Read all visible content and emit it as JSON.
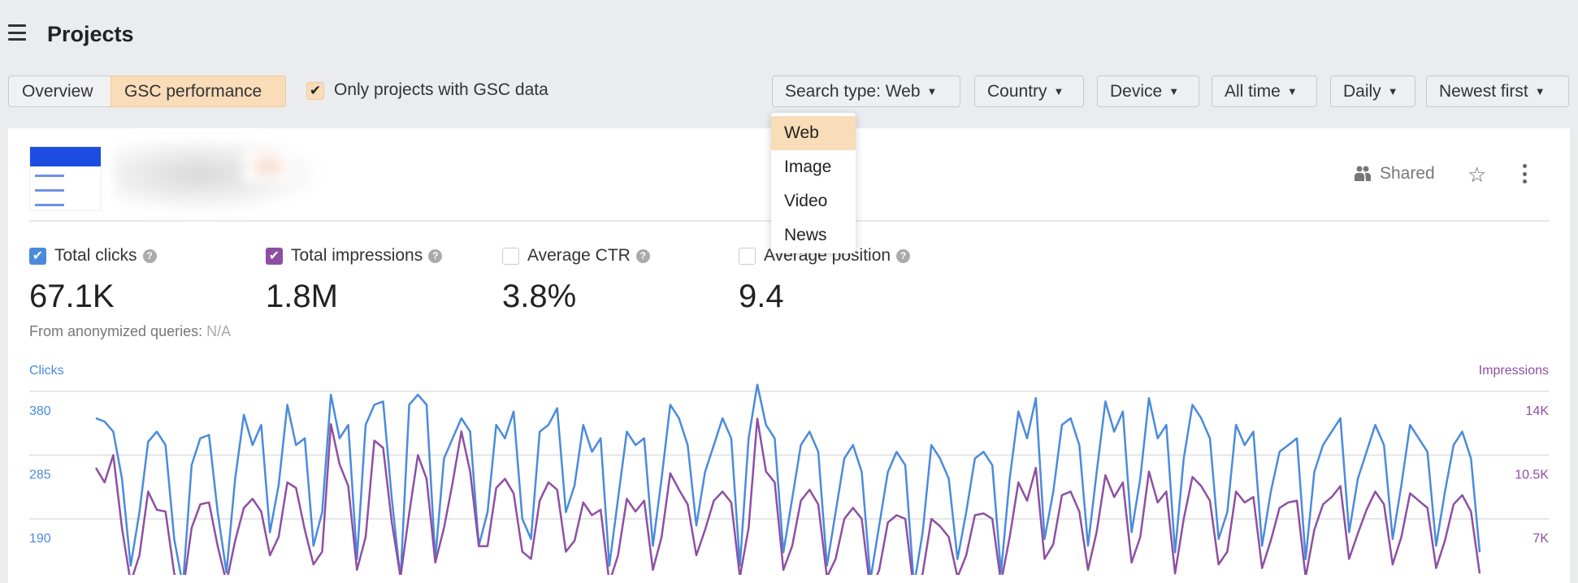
{
  "header": {
    "title": "Projects",
    "menu_icon": "hamburger-icon"
  },
  "tabs": [
    {
      "label": "Overview",
      "active": false
    },
    {
      "label": "GSC performance",
      "active": true
    }
  ],
  "gsc_filter": {
    "label": "Only projects with GSC data",
    "checked": true
  },
  "filters": [
    {
      "label": "Search type: Web"
    },
    {
      "label": "Country"
    },
    {
      "label": "Device"
    },
    {
      "label": "All time"
    },
    {
      "label": "Daily"
    },
    {
      "label": "Newest first"
    }
  ],
  "dropdown": {
    "items": [
      "Web",
      "Image",
      "Video",
      "News"
    ],
    "selected": "Web"
  },
  "project": {
    "shared_label": "Shared",
    "shared_icon": "users-icon",
    "star_icon": "star-icon",
    "more_icon": "more-vertical-icon"
  },
  "metrics": [
    {
      "label": "Total clicks",
      "value": "67.1K",
      "checked": true,
      "color": "#4a8bdc"
    },
    {
      "label": "Total impressions",
      "value": "1.8M",
      "checked": true,
      "color": "#8e4fa3"
    },
    {
      "label": "Average CTR",
      "value": "3.8%",
      "checked": false
    },
    {
      "label": "Average position",
      "value": "9.4",
      "checked": false
    }
  ],
  "anonymized": {
    "label": "From anonymized queries:",
    "value": "N/A"
  },
  "chart_data": {
    "type": "line",
    "left_axis": {
      "label": "Clicks",
      "ticks": [
        "380",
        "285",
        "190"
      ],
      "tick_values": [
        380,
        285,
        190
      ],
      "color": "#4a8bdc"
    },
    "right_axis": {
      "label": "Impressions",
      "ticks": [
        "14K",
        "10.5K",
        "7K"
      ],
      "tick_values": [
        14000,
        10500,
        7000
      ],
      "color": "#8e4fa3"
    },
    "grid": true,
    "series": [
      {
        "name": "Clicks",
        "axis": "left",
        "color": "#4a8bdc",
        "values": [
          340,
          335,
          320,
          250,
          120,
          200,
          305,
          320,
          300,
          160,
          90,
          270,
          310,
          315,
          200,
          110,
          250,
          345,
          300,
          330,
          170,
          240,
          360,
          300,
          310,
          150,
          200,
          375,
          310,
          330,
          130,
          330,
          360,
          365,
          220,
          100,
          360,
          375,
          360,
          130,
          280,
          310,
          340,
          320,
          150,
          200,
          330,
          310,
          350,
          190,
          160,
          320,
          330,
          355,
          200,
          240,
          330,
          290,
          310,
          120,
          220,
          320,
          300,
          310,
          150,
          250,
          360,
          340,
          300,
          180,
          260,
          300,
          340,
          310,
          120,
          310,
          390,
          330,
          310,
          140,
          220,
          300,
          320,
          290,
          120,
          200,
          280,
          300,
          260,
          100,
          180,
          260,
          290,
          270,
          90,
          170,
          300,
          280,
          250,
          130,
          200,
          280,
          290,
          270,
          110,
          250,
          350,
          310,
          370,
          160,
          230,
          330,
          340,
          300,
          150,
          260,
          365,
          320,
          350,
          170,
          250,
          370,
          310,
          330,
          140,
          280,
          360,
          340,
          310,
          160,
          200,
          330,
          300,
          320,
          150,
          230,
          290,
          300,
          310,
          130,
          260,
          300,
          320,
          340,
          170,
          250,
          290,
          330,
          300,
          160,
          240,
          330,
          310,
          290,
          150,
          230,
          300,
          320,
          280,
          140
        ]
      },
      {
        "name": "Impressions",
        "axis": "right",
        "color": "#8e4fa3",
        "values": [
          9800,
          9000,
          10500,
          6500,
          3500,
          5000,
          8500,
          7500,
          7400,
          4000,
          3000,
          6500,
          7800,
          7900,
          5500,
          3500,
          5800,
          7600,
          8100,
          7400,
          5000,
          6000,
          9000,
          8700,
          6400,
          4500,
          5200,
          12200,
          10000,
          8800,
          4200,
          6000,
          11300,
          10900,
          6800,
          3800,
          7300,
          10500,
          9200,
          4600,
          6500,
          9000,
          11800,
          9600,
          5500,
          5500,
          8700,
          9200,
          8400,
          5200,
          4800,
          8000,
          9000,
          8600,
          5200,
          5800,
          7900,
          7200,
          7500,
          3500,
          5000,
          8100,
          7400,
          8000,
          4200,
          6000,
          9500,
          8600,
          7800,
          5000,
          6400,
          8000,
          8500,
          7900,
          3800,
          6500,
          12500,
          9600,
          9000,
          4200,
          5500,
          8000,
          8600,
          7800,
          3800,
          4800,
          7000,
          7600,
          7000,
          3000,
          4200,
          6800,
          7200,
          7000,
          3000,
          4000,
          7000,
          6600,
          6000,
          3800,
          5000,
          7200,
          7300,
          7000,
          3500,
          6000,
          9000,
          8000,
          9800,
          4800,
          5600,
          8300,
          8500,
          7400,
          4200,
          6300,
          9400,
          8200,
          9000,
          4600,
          6000,
          9600,
          7900,
          8500,
          4000,
          7000,
          9300,
          8800,
          8000,
          4500,
          5200,
          8500,
          7900,
          8200,
          4300,
          5800,
          7600,
          7900,
          8000,
          3800,
          6400,
          7800,
          8200,
          8800,
          4800,
          6200,
          7500,
          8500,
          7800,
          4500,
          6000,
          8400,
          8000,
          7600,
          4300,
          5800,
          7800,
          8300,
          7400,
          4000
        ]
      }
    ]
  }
}
